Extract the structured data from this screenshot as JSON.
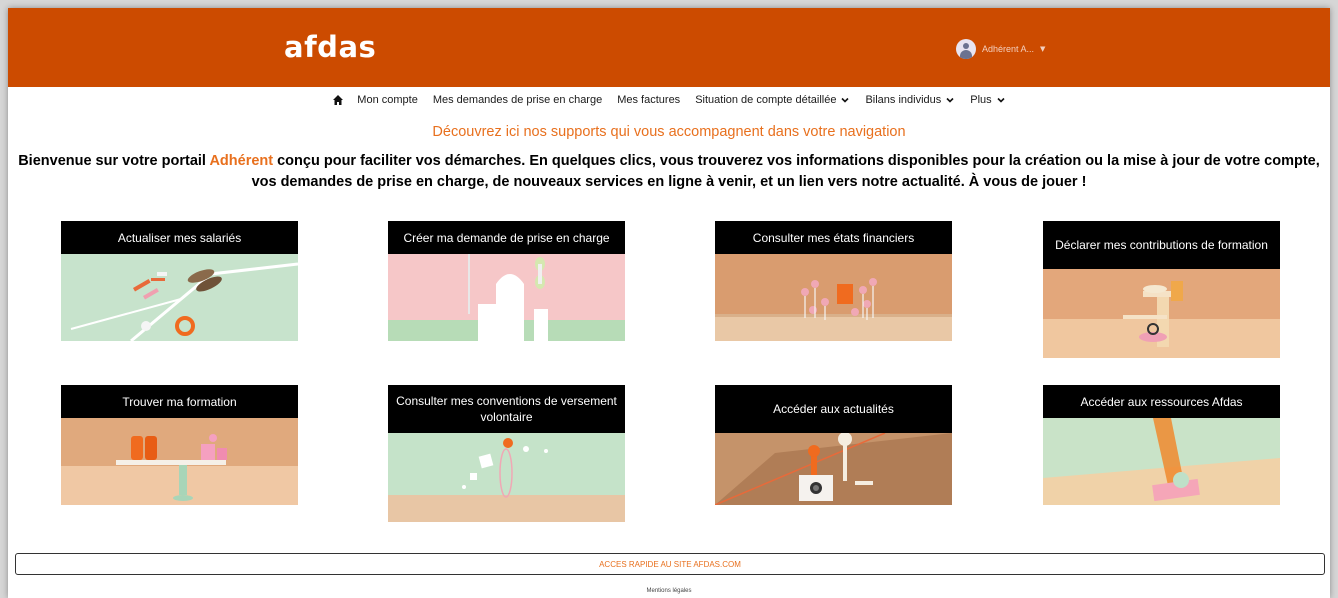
{
  "header": {
    "logo": "afdas",
    "user_name": "Adhérent A...",
    "background": "#cc4b00"
  },
  "nav": {
    "home_icon": "home-icon",
    "items": [
      {
        "label": "Mon compte",
        "dropdown": false
      },
      {
        "label": "Mes demandes de prise en charge",
        "dropdown": false
      },
      {
        "label": "Mes factures",
        "dropdown": false
      },
      {
        "label": "Situation de compte détaillée",
        "dropdown": true
      },
      {
        "label": "Bilans individus",
        "dropdown": true
      },
      {
        "label": "Plus",
        "dropdown": true
      }
    ]
  },
  "main": {
    "tagline": "Découvrez ici nos supports qui vous accompagnent dans votre navigation",
    "welcome_before": "Bienvenue sur votre portail ",
    "welcome_accent": "Adhérent",
    "welcome_after": " conçu pour faciliter vos démarches. En quelques clics, vous trouverez vos informations disponibles pour la création ou la mise à jour de votre compte, vos demandes de prise en charge, de nouveaux services en ligne à venir, et un lien vers notre actualité. À vous de jouer !",
    "accent_color": "#e8701e"
  },
  "cards": [
    {
      "title": "Actualiser mes salariés"
    },
    {
      "title": "Créer ma demande de prise en charge"
    },
    {
      "title": "Consulter mes états financiers"
    },
    {
      "title": "Déclarer mes contributions de formation"
    },
    {
      "title": "Trouver ma formation"
    },
    {
      "title": "Consulter mes conventions de versement volontaire"
    },
    {
      "title": "Accéder aux actualités"
    },
    {
      "title": "Accéder aux ressources Afdas"
    }
  ],
  "footer": {
    "quick_access": "ACCES RAPIDE AU SITE AFDAS.COM",
    "legal": "Mentions légales"
  }
}
